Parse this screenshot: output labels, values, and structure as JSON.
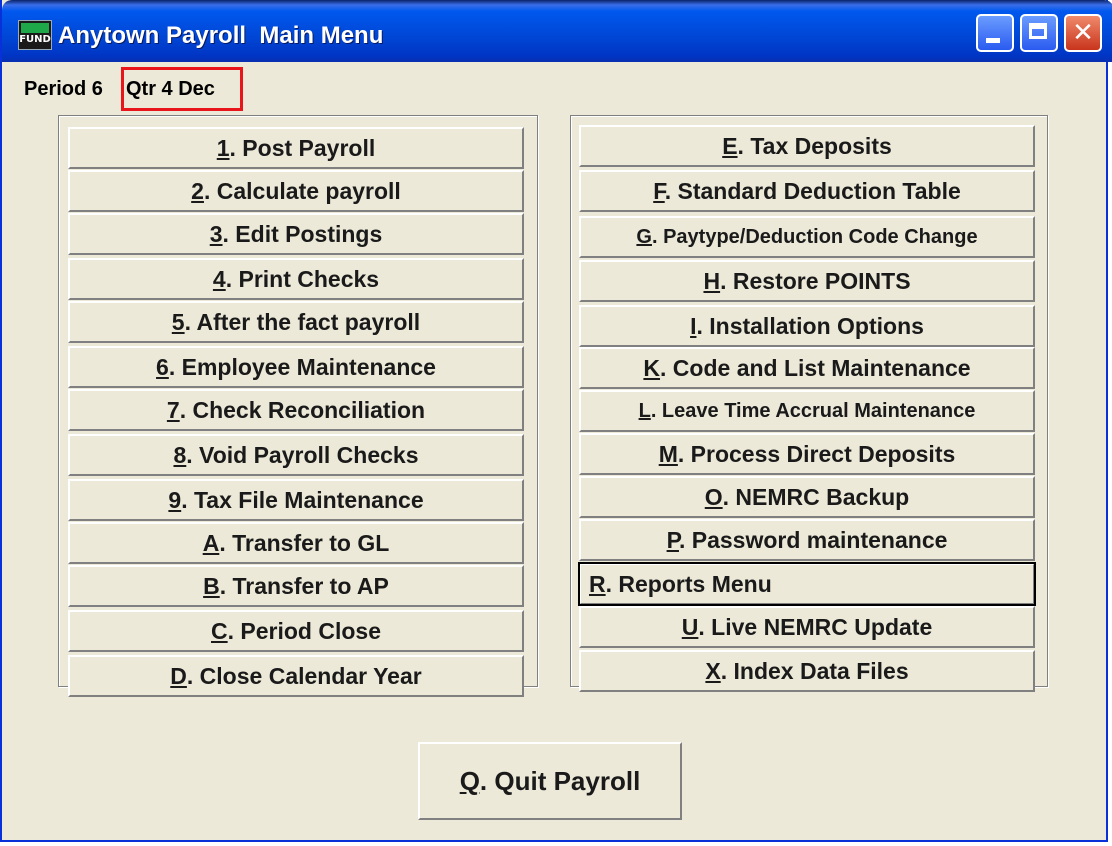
{
  "window": {
    "title": "Anytown Payroll  Main Menu",
    "icon_text": "FUND"
  },
  "status": {
    "period_label": "Period 6",
    "quarter_label": "Qtr 4 Dec"
  },
  "menu_left": [
    {
      "key": "1",
      "label": ". Post Payroll"
    },
    {
      "key": "2",
      "label": ". Calculate payroll"
    },
    {
      "key": "3",
      "label": ". Edit Postings"
    },
    {
      "key": "4",
      "label": ". Print Checks"
    },
    {
      "key": "5",
      "label": ". After the fact payroll"
    },
    {
      "key": "6",
      "label": ". Employee Maintenance"
    },
    {
      "key": "7",
      "label": ". Check Reconciliation"
    },
    {
      "key": "8",
      "label": ". Void Payroll Checks"
    },
    {
      "key": "9",
      "label": ". Tax File Maintenance"
    },
    {
      "key": "A",
      "label": ". Transfer to GL"
    },
    {
      "key": "B",
      "label": ". Transfer to AP"
    },
    {
      "key": "C",
      "label": ". Period Close"
    },
    {
      "key": "D",
      "label": ". Close Calendar Year"
    }
  ],
  "menu_right": [
    {
      "key": "E",
      "label": ". Tax Deposits"
    },
    {
      "key": "F",
      "label": ". Standard Deduction Table"
    },
    {
      "key": "G",
      "label": ". Paytype/Deduction Code Change"
    },
    {
      "key": "H",
      "label": ".  Restore POINTS"
    },
    {
      "key": "I",
      "label": ".  Installation Options"
    },
    {
      "key": "K",
      "label": ". Code and List Maintenance"
    },
    {
      "key": "L",
      "label": ". Leave Time Accrual Maintenance"
    },
    {
      "key": "M",
      "label": ". Process Direct Deposits"
    },
    {
      "key": "O",
      "label": ". NEMRC Backup"
    },
    {
      "key": "P",
      "label": ".  Password maintenance"
    },
    {
      "key": "R",
      "label": ".  Reports Menu"
    },
    {
      "key": "U",
      "label": ". Live NEMRC Update"
    },
    {
      "key": "X",
      "label": ".  Index Data Files"
    }
  ],
  "quit": {
    "key": "Q",
    "label": ". Quit Payroll"
  },
  "colors": {
    "titlebar": "#0046d5",
    "window_bg": "#ece9d8",
    "highlight": "#e8151b"
  }
}
